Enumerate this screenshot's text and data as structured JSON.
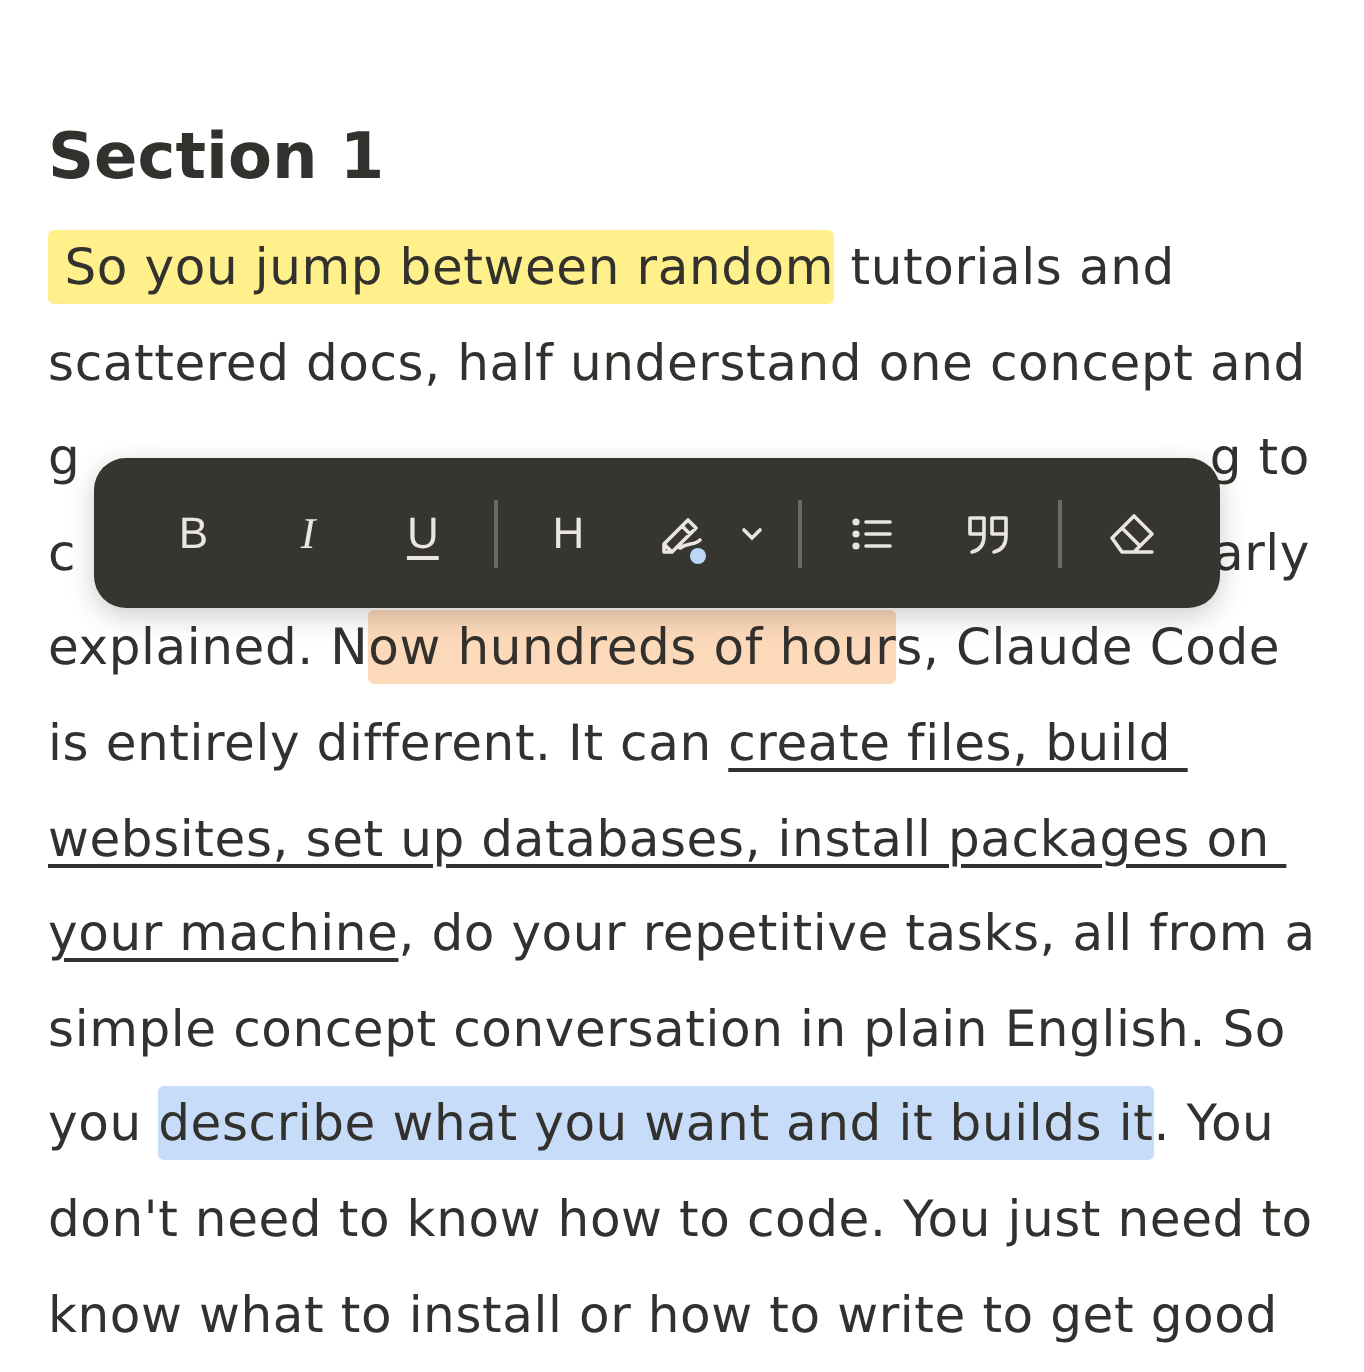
{
  "heading": "Section 1",
  "lines": [
    {
      "kind": "full",
      "segments": [
        {
          "text": " So you jump between random",
          "color": "#fff08c"
        },
        {
          "text": " tutorials and"
        }
      ]
    },
    {
      "kind": "full",
      "segments": [
        {
          "text": "scattered docs, half understand one concept and"
        }
      ]
    },
    {
      "kind": "covered",
      "left": "g",
      "right": "g to"
    },
    {
      "kind": "covered",
      "left": "c",
      "right": "arly"
    },
    {
      "kind": "full",
      "segments": [
        {
          "text": "explained. N"
        },
        {
          "text": "ow hundreds of hour",
          "color": "#fcd9b9"
        },
        {
          "text": "s, Claude Code"
        }
      ]
    },
    {
      "kind": "full",
      "segments": [
        {
          "text": "is entirely different. It can "
        },
        {
          "text": "create files, build ",
          "underlined": true
        }
      ]
    },
    {
      "kind": "full",
      "segments": [
        {
          "text": "websites, set up databases, install packages on ",
          "underlined": true
        }
      ]
    },
    {
      "kind": "full",
      "segments": [
        {
          "text": "your machine",
          "underlined": true
        },
        {
          "text": ", do your repetitive tasks, all from a"
        }
      ]
    },
    {
      "kind": "full",
      "segments": [
        {
          "text": "simple concept conversation in plain English. So"
        }
      ]
    },
    {
      "kind": "full",
      "segments": [
        {
          "text": "you "
        },
        {
          "text": "describe what you want and it builds it",
          "color": "#c6dcf8"
        },
        {
          "text": ". You"
        }
      ]
    },
    {
      "kind": "full",
      "segments": [
        {
          "text": "don't need to know how to code. You just need to"
        }
      ]
    },
    {
      "kind": "full",
      "segments": [
        {
          "text": "know what to install or how to write to get good"
        }
      ]
    }
  ],
  "toolbar": [
    {
      "kind": "bold",
      "label": "B"
    },
    {
      "kind": "italic",
      "label": "I"
    },
    {
      "kind": "underline",
      "label": "U"
    },
    {
      "kind": "divider"
    },
    {
      "kind": "heading",
      "label": "H"
    },
    {
      "kind": "highlighter",
      "color": "#bcd6f7"
    },
    {
      "kind": "caret"
    },
    {
      "kind": "divider"
    },
    {
      "kind": "list"
    },
    {
      "kind": "quote"
    },
    {
      "kind": "divider"
    },
    {
      "kind": "eraser"
    }
  ]
}
